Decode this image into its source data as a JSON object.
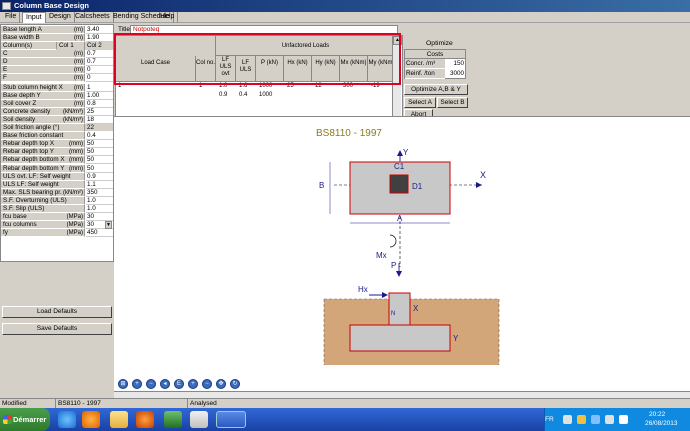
{
  "window": {
    "title": "Column Base Design"
  },
  "menu": [
    {
      "label": "File",
      "active": false
    },
    {
      "label": "Input",
      "active": true
    },
    {
      "label": "Design",
      "active": false
    },
    {
      "label": "Calcsheets",
      "active": false
    },
    {
      "label": "Bending Schedule",
      "active": false
    },
    {
      "label": "Help",
      "active": false
    }
  ],
  "params": {
    "base_length": {
      "label": "Base length A",
      "unit": "(m)",
      "value": "3.40"
    },
    "base_width": {
      "label": "Base width B",
      "unit": "(m)",
      "value": "1.90"
    },
    "columns_header": {
      "label": "Column(s)",
      "col1": "Col 1",
      "col2": "Col 2"
    },
    "col_rows": [
      {
        "label": "C",
        "unit": "(m)",
        "value": "0.7"
      },
      {
        "label": "D",
        "unit": "(m)",
        "value": "0.7"
      },
      {
        "label": "E",
        "unit": "(m)",
        "value": "0"
      },
      {
        "label": "F",
        "unit": "(m)",
        "value": "0"
      }
    ],
    "rows": [
      {
        "label": "Stub column height X",
        "unit": "(m)",
        "value": "1"
      },
      {
        "label": "Base depth Y",
        "unit": "(m)",
        "value": "1.00"
      },
      {
        "label": "Soil cover Z",
        "unit": "(m)",
        "value": "0.8"
      },
      {
        "label": "Concrete density",
        "unit": "(kN/m³)",
        "value": "25"
      },
      {
        "label": "Soil density",
        "unit": "(kN/m³)",
        "value": "18"
      },
      {
        "label": "Soil friction angle (°)",
        "unit": "",
        "value": "22",
        "grey": true
      },
      {
        "label": "Base friction constant",
        "unit": "",
        "value": "0.4"
      },
      {
        "label": "Rebar depth top X",
        "unit": "(mm)",
        "value": "50"
      },
      {
        "label": "Rebar depth top Y",
        "unit": "(mm)",
        "value": "50"
      },
      {
        "label": "Rebar depth bottom X",
        "unit": "(mm)",
        "value": "50"
      },
      {
        "label": "Rebar depth bottom Y",
        "unit": "(mm)",
        "value": "50"
      },
      {
        "label": "ULS ovt. LF: Self weight",
        "unit": "",
        "value": "0.9"
      },
      {
        "label": "ULS LF: Self weight",
        "unit": "",
        "value": "1.1"
      },
      {
        "label": "Max. SLS bearing pr.",
        "unit": "(kN/m²)",
        "value": "350"
      },
      {
        "label": "S.F. Overturning (ULS)",
        "unit": "",
        "value": "1.0"
      },
      {
        "label": "S.F. Slip (ULS)",
        "unit": "",
        "value": "1.0"
      },
      {
        "label": "fcu base",
        "unit": "(MPa)",
        "value": "30"
      },
      {
        "label": "fcu columns",
        "unit": "(MPa)",
        "value": "30",
        "combo": true
      },
      {
        "label": "fy",
        "unit": "(MPa)",
        "value": "450"
      }
    ]
  },
  "buttons": {
    "load_defaults": "Load Defaults",
    "save_defaults": "Save Defaults",
    "optimize_ab_y": "Optimize A,B & Y",
    "select_a": "Select A",
    "select_b": "Select B",
    "abort": "Abort"
  },
  "title_field": {
    "label": "Title:",
    "value": "Notpoteq"
  },
  "loads_table": {
    "group_header": "Unfactored Loads",
    "columns": [
      "Load Case",
      "Col no.",
      "LF ULS ovt",
      "LF ULS",
      "P (kN)",
      "Hx (kN)",
      "Hy (kN)",
      "Mx (kNm)",
      "My (kNm)"
    ],
    "rows": [
      [
        "1",
        "1",
        "1.0",
        "1.6",
        "1000",
        "25",
        "12",
        "300",
        "-19"
      ],
      [
        "",
        "",
        "0.9",
        "0.4",
        "1000",
        "",
        "",
        "",
        ""
      ]
    ]
  },
  "optimize": {
    "title": "Optimize",
    "costs_header": "Costs",
    "concrete_label": "Concr.    /m³",
    "concrete_value": "150",
    "rebar_label": "Reinf.    /ton",
    "rebar_value": "3000"
  },
  "drawing": {
    "code": "BS8110 - 1997",
    "labels": {
      "y_top": "Y",
      "x_axis": "X",
      "c1": "C1",
      "d1": "D1",
      "a": "A",
      "b": "B",
      "mx": "Mx",
      "p": "P",
      "hx": "Hx",
      "x_side": "X",
      "y_side": "Y",
      "n": "N"
    }
  },
  "status": {
    "state": "Modified",
    "code": "BS8110 - 1997",
    "analysed": "Analysed"
  },
  "taskbar": {
    "start": "Démarrer",
    "lang": "FR",
    "time": "20:22",
    "date": "26/08/2013"
  },
  "colors": {
    "red_highlight": "#e00020",
    "base_fill": "#d2a679",
    "column_grey": "#c8c8c8",
    "title_bar": "#0a246a"
  }
}
